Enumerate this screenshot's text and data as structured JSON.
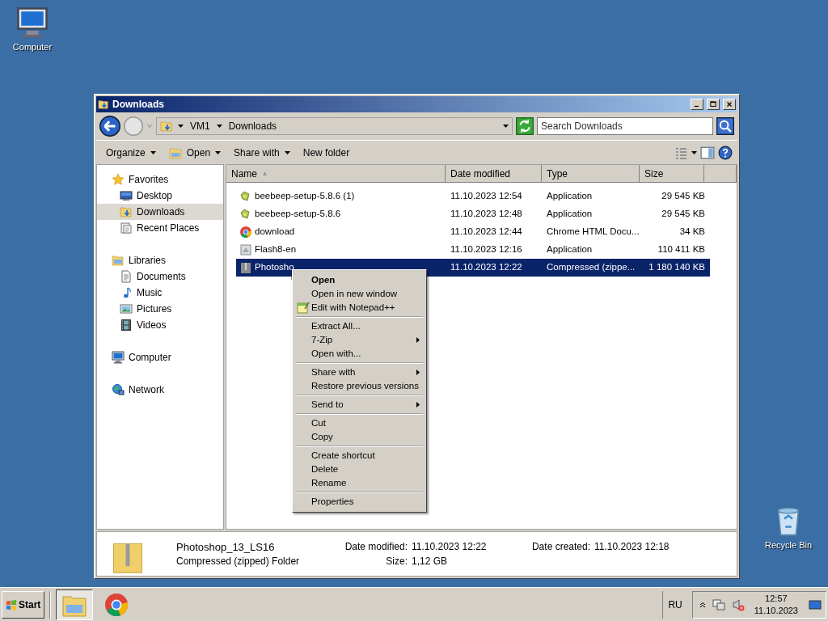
{
  "desktop_icons": [
    {
      "label": "Computer",
      "kind": "computer"
    },
    {
      "label": "Recycle Bin",
      "kind": "recycle"
    }
  ],
  "window": {
    "title": "Downloads"
  },
  "address": {
    "path": [
      "VM1",
      "Downloads"
    ]
  },
  "search": {
    "placeholder": "Search Downloads"
  },
  "toolbar": [
    {
      "label": "Organize",
      "kind": "menu"
    },
    {
      "label": "Open",
      "kind": "open"
    },
    {
      "label": "Share with",
      "kind": "menu"
    },
    {
      "label": "New folder",
      "kind": "plain"
    }
  ],
  "nav": [
    {
      "label": "Favorites",
      "kind": "star",
      "selected": false,
      "children": [
        {
          "label": "Desktop",
          "kind": "desktop",
          "selected": false
        },
        {
          "label": "Downloads",
          "kind": "downloads",
          "selected": true
        },
        {
          "label": "Recent Places",
          "kind": "recent",
          "selected": false
        }
      ]
    },
    {
      "label": "Libraries",
      "kind": "libraries",
      "selected": false,
      "children": [
        {
          "label": "Documents",
          "kind": "document",
          "selected": false
        },
        {
          "label": "Music",
          "kind": "music",
          "selected": false
        },
        {
          "label": "Pictures",
          "kind": "pictures",
          "selected": false
        },
        {
          "label": "Videos",
          "kind": "videos",
          "selected": false
        }
      ]
    },
    {
      "label": "Computer",
      "kind": "computer",
      "selected": false
    },
    {
      "label": "Network",
      "kind": "network",
      "selected": false
    }
  ],
  "table": {
    "columns": [
      "Name",
      "Date modified",
      "Type",
      "Size"
    ],
    "rows": [
      {
        "name": "beebeep-setup-5.8.6 (1)",
        "date": "11.10.2023 12:54",
        "type": "Application",
        "size": "29 545 KB",
        "kind": "app",
        "selected": false
      },
      {
        "name": "beebeep-setup-5.8.6",
        "date": "11.10.2023 12:48",
        "type": "Application",
        "size": "29 545 KB",
        "kind": "app",
        "selected": false
      },
      {
        "name": "download",
        "date": "11.10.2023 12:44",
        "type": "Chrome HTML Docu...",
        "size": "34 KB",
        "kind": "chrome",
        "selected": false
      },
      {
        "name": "Flash8-en",
        "date": "11.10.2023 12:16",
        "type": "Application",
        "size": "110 411 KB",
        "kind": "installer",
        "selected": false
      },
      {
        "name": "Photosho",
        "date": "11.10.2023 12:22",
        "type": "Compressed (zippe...",
        "size": "1 180 140 KB",
        "kind": "zip",
        "selected": true
      }
    ]
  },
  "context_menu": {
    "groups": [
      [
        {
          "label": "Open",
          "kind": "default"
        },
        {
          "label": "Open in new window",
          "kind": "plain"
        },
        {
          "label": "Edit with Notepad++",
          "kind": "notepad"
        }
      ],
      [
        {
          "label": "Extract All...",
          "kind": "plain"
        },
        {
          "label": "7-Zip",
          "kind": "submenu"
        },
        {
          "label": "Open with...",
          "kind": "plain"
        }
      ],
      [
        {
          "label": "Share with",
          "kind": "submenu"
        },
        {
          "label": "Restore previous versions",
          "kind": "plain"
        }
      ],
      [
        {
          "label": "Send to",
          "kind": "submenu"
        }
      ],
      [
        {
          "label": "Cut",
          "kind": "plain"
        },
        {
          "label": "Copy",
          "kind": "plain"
        }
      ],
      [
        {
          "label": "Create shortcut",
          "kind": "plain"
        },
        {
          "label": "Delete",
          "kind": "plain"
        },
        {
          "label": "Rename",
          "kind": "plain"
        }
      ],
      [
        {
          "label": "Properties",
          "kind": "plain"
        }
      ]
    ]
  },
  "details": {
    "name": "Photoshop_13_LS16",
    "type": "Compressed (zipped) Folder",
    "fields": [
      {
        "label": "Date modified:",
        "value": "11.10.2023 12:22"
      },
      {
        "label": "Size:",
        "value": "1,12 GB"
      },
      {
        "label": "Date created:",
        "value": "11.10.2023 12:18"
      }
    ]
  },
  "taskbar": {
    "start": "Start",
    "apps": [
      {
        "kind": "explorer",
        "selected": true
      },
      {
        "kind": "chrome",
        "selected": false
      }
    ],
    "language": "RU",
    "time": "12:57",
    "date": "11.10.2023"
  }
}
